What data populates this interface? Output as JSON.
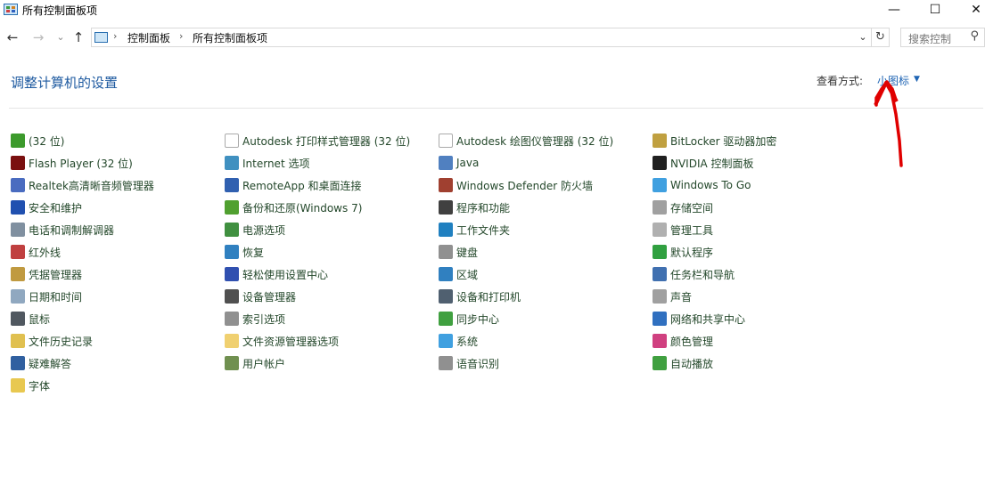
{
  "window": {
    "title": "所有控制面板项",
    "minimize": "—",
    "maximize": "☐",
    "close": "✕"
  },
  "nav": {
    "back": "←",
    "forward": "→",
    "recent": "⌄",
    "up": "↑",
    "breadcrumb": [
      "控制面板",
      "所有控制面板项"
    ],
    "separator": "›",
    "refresh": "↻",
    "search_placeholder": "搜索控制",
    "search_icon": "⚲"
  },
  "heading": "调整计算机的设置",
  "view": {
    "label": "查看方式:",
    "value": "小图标",
    "caret": "▼"
  },
  "columns": [
    [
      {
        "label": "(32 位)",
        "icon": "app-32bit-icon",
        "color": "#3c9a2c"
      },
      {
        "label": "Flash Player (32 位)",
        "icon": "flash-player-icon",
        "color": "#7a1010"
      },
      {
        "label": "Realtek高清晰音频管理器",
        "icon": "realtek-audio-icon",
        "color": "#4a6cc0"
      },
      {
        "label": "安全和维护",
        "icon": "flag-icon",
        "color": "#2050b0"
      },
      {
        "label": "电话和调制解调器",
        "icon": "phone-modem-icon",
        "color": "#8090a0"
      },
      {
        "label": "红外线",
        "icon": "infrared-icon",
        "color": "#c04040"
      },
      {
        "label": "凭据管理器",
        "icon": "credential-manager-icon",
        "color": "#c09a40"
      },
      {
        "label": "日期和时间",
        "icon": "date-time-icon",
        "color": "#90a8c0"
      },
      {
        "label": "鼠标",
        "icon": "mouse-icon",
        "color": "#505860"
      },
      {
        "label": "文件历史记录",
        "icon": "file-history-icon",
        "color": "#e0c050"
      },
      {
        "label": "疑难解答",
        "icon": "troubleshoot-icon",
        "color": "#3060a0"
      },
      {
        "label": "字体",
        "icon": "fonts-icon",
        "color": "#e8c850"
      }
    ],
    [
      {
        "label": "Autodesk 打印样式管理器 (32 位)",
        "icon": "document-icon",
        "color": "#eeeeee"
      },
      {
        "label": "Internet 选项",
        "icon": "internet-options-icon",
        "color": "#4090c0"
      },
      {
        "label": "RemoteApp 和桌面连接",
        "icon": "remoteapp-icon",
        "color": "#3060b0"
      },
      {
        "label": "备份和还原(Windows 7)",
        "icon": "backup-restore-icon",
        "color": "#50a030"
      },
      {
        "label": "电源选项",
        "icon": "power-options-icon",
        "color": "#409040"
      },
      {
        "label": "恢复",
        "icon": "recovery-icon",
        "color": "#3080c0"
      },
      {
        "label": "轻松使用设置中心",
        "icon": "ease-of-access-icon",
        "color": "#3050b0"
      },
      {
        "label": "设备管理器",
        "icon": "device-manager-icon",
        "color": "#505050"
      },
      {
        "label": "索引选项",
        "icon": "indexing-icon",
        "color": "#909090"
      },
      {
        "label": "文件资源管理器选项",
        "icon": "folder-options-icon",
        "color": "#f0d070"
      },
      {
        "label": "用户帐户",
        "icon": "user-accounts-icon",
        "color": "#709050"
      }
    ],
    [
      {
        "label": "Autodesk 绘图仪管理器 (32 位)",
        "icon": "document-icon",
        "color": "#eeeeee"
      },
      {
        "label": "Java",
        "icon": "java-icon",
        "color": "#5080c0"
      },
      {
        "label": "Windows Defender 防火墙",
        "icon": "firewall-icon",
        "color": "#a04030"
      },
      {
        "label": "程序和功能",
        "icon": "programs-features-icon",
        "color": "#404040"
      },
      {
        "label": "工作文件夹",
        "icon": "work-folders-icon",
        "color": "#2080c0"
      },
      {
        "label": "键盘",
        "icon": "keyboard-icon",
        "color": "#909090"
      },
      {
        "label": "区域",
        "icon": "region-icon",
        "color": "#3080c0"
      },
      {
        "label": "设备和打印机",
        "icon": "devices-printers-icon",
        "color": "#506070"
      },
      {
        "label": "同步中心",
        "icon": "sync-center-icon",
        "color": "#40a040"
      },
      {
        "label": "系统",
        "icon": "system-icon",
        "color": "#40a0e0"
      },
      {
        "label": "语音识别",
        "icon": "microphone-icon",
        "color": "#909090"
      }
    ],
    [
      {
        "label": "BitLocker 驱动器加密",
        "icon": "bitlocker-icon",
        "color": "#c0a040"
      },
      {
        "label": "NVIDIA 控制面板",
        "icon": "nvidia-icon",
        "color": "#202020"
      },
      {
        "label": "Windows To Go",
        "icon": "windows-to-go-icon",
        "color": "#40a0e0"
      },
      {
        "label": "存储空间",
        "icon": "storage-spaces-icon",
        "color": "#a0a0a0"
      },
      {
        "label": "管理工具",
        "icon": "admin-tools-icon",
        "color": "#b0b0b0"
      },
      {
        "label": "默认程序",
        "icon": "default-programs-icon",
        "color": "#30a040"
      },
      {
        "label": "任务栏和导航",
        "icon": "taskbar-icon",
        "color": "#4070b0"
      },
      {
        "label": "声音",
        "icon": "speaker-icon",
        "color": "#a0a0a0"
      },
      {
        "label": "网络和共享中心",
        "icon": "network-sharing-icon",
        "color": "#3070c0"
      },
      {
        "label": "颜色管理",
        "icon": "color-management-icon",
        "color": "#d04080"
      },
      {
        "label": "自动播放",
        "icon": "autoplay-icon",
        "color": "#40a040"
      }
    ]
  ]
}
